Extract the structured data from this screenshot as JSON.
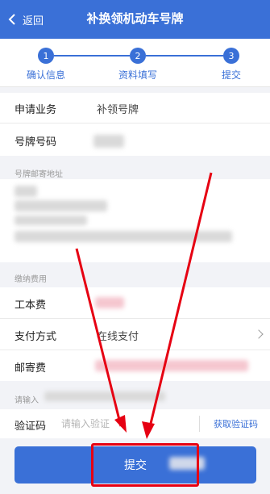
{
  "header": {
    "back_label": "返回",
    "title": "补换领机动车号牌"
  },
  "steps": [
    {
      "num": "1",
      "label": "确认信息"
    },
    {
      "num": "2",
      "label": "资料填写"
    },
    {
      "num": "3",
      "label": "提交"
    }
  ],
  "form": {
    "business_label": "申请业务",
    "business_value": "补领号牌",
    "plate_label": "号牌号码",
    "address_section": "号牌邮寄地址",
    "fee_section": "缴纳费用",
    "cost_label": "工本费",
    "payment_label": "支付方式",
    "payment_value": "在线支付",
    "postage_label": "邮寄费",
    "input_hint": "请输入",
    "vcode_label": "验证码",
    "vcode_placeholder": "请输入验证",
    "vcode_button": "获取验证码"
  },
  "submit_label": "提交",
  "colors": {
    "primary": "#3a70d7",
    "highlight": "#e60012"
  }
}
